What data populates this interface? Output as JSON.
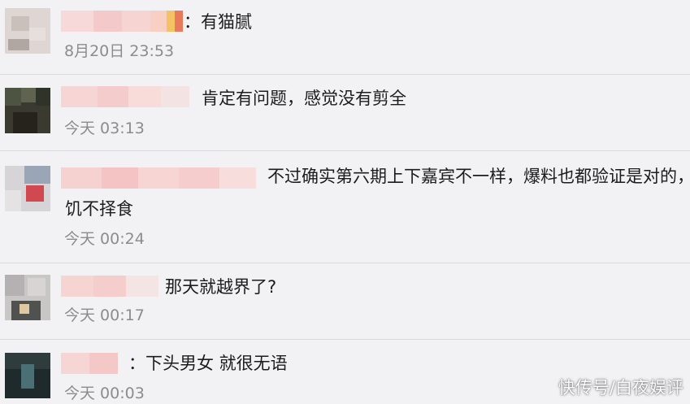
{
  "comments": [
    {
      "text": "：有猫腻",
      "time": "8月20日 23:53"
    },
    {
      "text": "肯定有问题，感觉没有剪全",
      "time": "今天 03:13"
    },
    {
      "text": "不过确实第六期上下嘉宾不一样，爆料也都验证是对的，",
      "text2": "饥不择食",
      "time": "今天 00:24"
    },
    {
      "text": "那天就越界了?",
      "time": "今天 00:17"
    },
    {
      "text": "：下头男女 就很无语",
      "time": "今天 00:03"
    }
  ],
  "watermark": "快传号/白夜娱评",
  "colors": {
    "background": "#f2f2f5",
    "text": "#1c1c1c",
    "timestamp": "#8c8c8c",
    "divider": "#dadade"
  }
}
